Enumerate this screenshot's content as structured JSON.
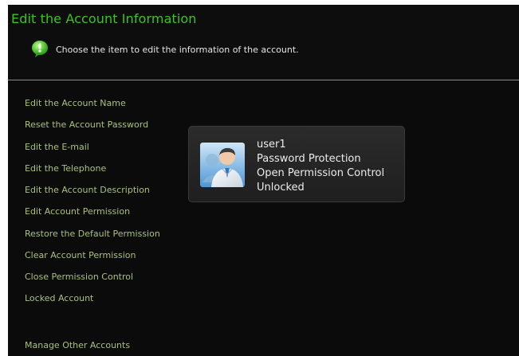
{
  "title": "Edit the Account Information",
  "hint": {
    "icon": "speech-bubble-info-icon",
    "text": "Choose the item to edit the information of the account."
  },
  "menu": {
    "items": [
      {
        "label": "Edit the Account Name"
      },
      {
        "label": "Reset the Account Password"
      },
      {
        "label": "Edit the E-mail"
      },
      {
        "label": "Edit the Telephone"
      },
      {
        "label": "Edit the Account Description"
      },
      {
        "label": "Edit Account Permission"
      },
      {
        "label": "Restore the Default Permission"
      },
      {
        "label": "Clear Account Permission"
      },
      {
        "label": "Close Permission Control"
      },
      {
        "label": "Locked Account"
      }
    ],
    "footer_item": {
      "label": "Manage Other Accounts"
    }
  },
  "account_card": {
    "avatar_icon": "user-avatar-icon",
    "username": "user1",
    "protection": "Password Protection",
    "permission": "Open Permission Control",
    "lock_status": "Unlocked"
  },
  "colors": {
    "title": "#39c51f",
    "menu_text": "#a9c27a",
    "background": "#0b0b0b",
    "card_text": "#ececec"
  }
}
